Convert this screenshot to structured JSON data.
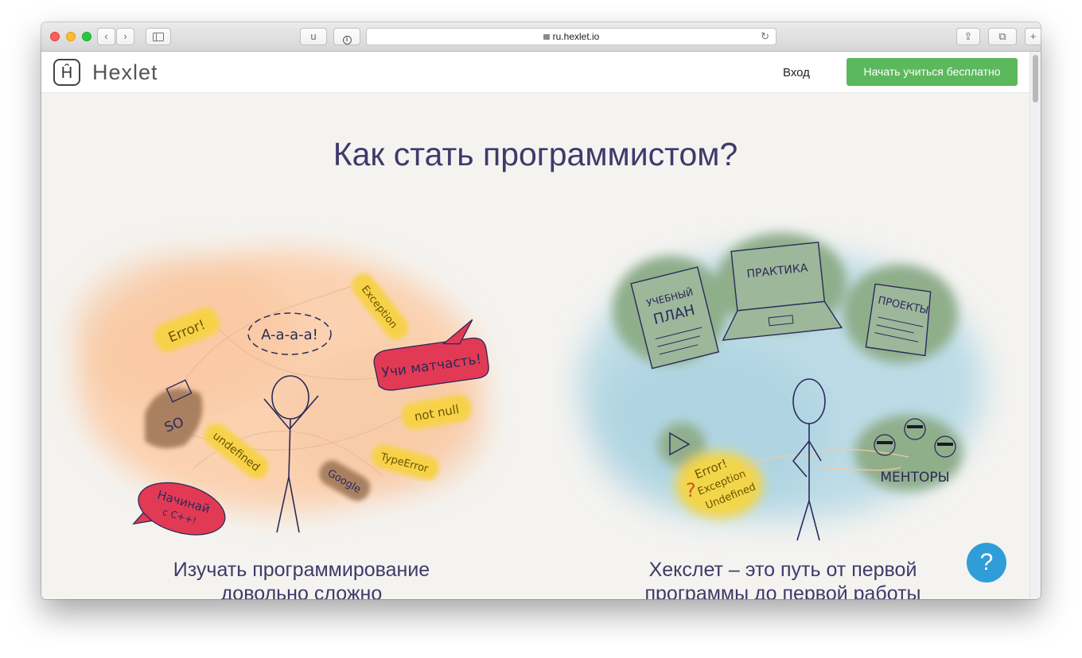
{
  "browser": {
    "tab_text": "u",
    "url": "ru.hexlet.io",
    "info_icon": "info-icon",
    "new_tab_icon": "plus-icon"
  },
  "nav": {
    "logo_letter": "Ĥ",
    "brand": "Hexlet",
    "login": "Вход",
    "cta": "Начать учиться бесплатно"
  },
  "hero": {
    "title": "Как стать программистом?"
  },
  "left_panel": {
    "caption_line1": "Изучать программирование",
    "caption_line2": "довольно сложно",
    "bubbles": {
      "error": "Error!",
      "scream": "A-a-a-a!",
      "exception": "Exception",
      "learn": "Учи матчасть!",
      "so": "SO",
      "not_null": "not null",
      "undefined": "undefined",
      "type_error": "TypeError",
      "google": "Google",
      "start_line1": "Начинай",
      "start_line2": "с C++!"
    }
  },
  "right_panel": {
    "caption_line1": "Хекслет – это путь от первой",
    "caption_line2": "программы до первой работы",
    "items": {
      "plan_line1": "УЧЕБНЫЙ",
      "plan_line2": "ПЛАН",
      "practice": "ПРАКТИКА",
      "projects": "ПРОЕКТЫ",
      "mentors": "МЕНТОРЫ",
      "err_line1": "Error!",
      "err_line2": "Exception",
      "err_line3": "Undefined"
    }
  },
  "help": {
    "symbol": "?"
  },
  "colors": {
    "title": "#3e3a6b",
    "cta": "#5cb85c",
    "help": "#2f9ed8"
  }
}
